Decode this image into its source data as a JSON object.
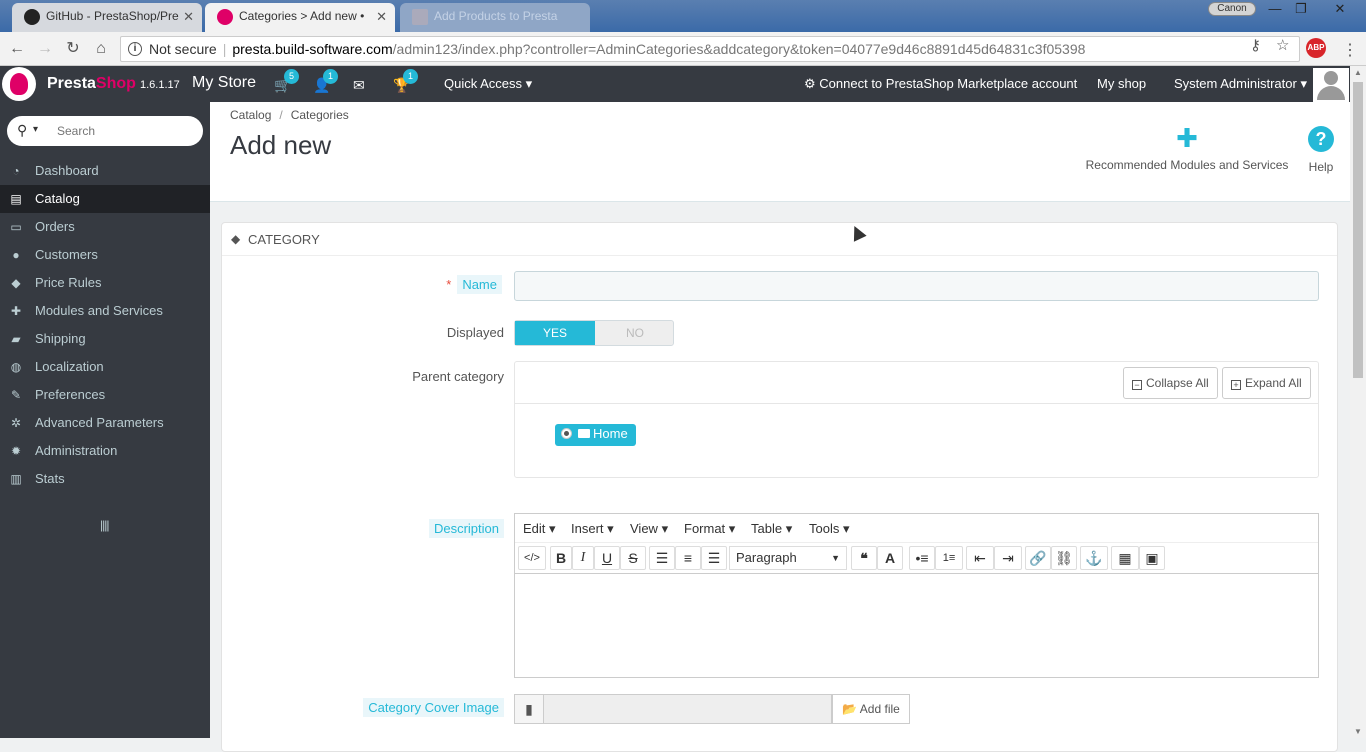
{
  "browser": {
    "tabs": [
      {
        "title": "GitHub - PrestaShop/Pre",
        "close": "✕"
      },
      {
        "title": "Categories > Add new • ",
        "close": "✕"
      },
      {
        "title": "Add Products to Presta",
        "close": ""
      }
    ],
    "canon_label": "Canon",
    "window_controls": {
      "minimize": "—",
      "maximize": "❐",
      "close": "✕"
    },
    "security_label": "Not secure",
    "url_host": "presta.build-software.com",
    "url_path": "/admin123/index.php?controller=AdminCategories&addcategory&token=04077e9d46c8891d45d64831c3f05398",
    "abp_label": "ABP"
  },
  "header": {
    "logo_presta": "Presta",
    "logo_shop": "Shop",
    "version": "1.6.1.17",
    "store_name": "My Store",
    "badges": {
      "orders": "5",
      "customers": "1",
      "achievements": "1"
    },
    "quick_access": "Quick Access",
    "marketplace": "Connect to PrestaShop Marketplace account",
    "my_shop": "My shop",
    "user": "System Administrator"
  },
  "sidebar": {
    "search_placeholder": "Search",
    "items": [
      {
        "label": "Dashboard",
        "icon": "dashboard-icon",
        "glyph": "◔"
      },
      {
        "label": "Catalog",
        "icon": "book-icon",
        "glyph": "▤"
      },
      {
        "label": "Orders",
        "icon": "credit-card-icon",
        "glyph": "▭"
      },
      {
        "label": "Customers",
        "icon": "users-icon",
        "glyph": "●"
      },
      {
        "label": "Price Rules",
        "icon": "tags-icon",
        "glyph": "◆"
      },
      {
        "label": "Modules and Services",
        "icon": "puzzle-icon",
        "glyph": "✚"
      },
      {
        "label": "Shipping",
        "icon": "truck-icon",
        "glyph": "▰"
      },
      {
        "label": "Localization",
        "icon": "globe-icon",
        "glyph": "◍"
      },
      {
        "label": "Preferences",
        "icon": "wrench-icon",
        "glyph": "✎"
      },
      {
        "label": "Advanced Parameters",
        "icon": "cogs-icon",
        "glyph": "✲"
      },
      {
        "label": "Administration",
        "icon": "cog-icon",
        "glyph": "✹"
      },
      {
        "label": "Stats",
        "icon": "bar-chart-icon",
        "glyph": "▥"
      }
    ],
    "active_index": 1,
    "collapse_glyph": "||||"
  },
  "page": {
    "breadcrumb": [
      "Catalog",
      "Categories"
    ],
    "title": "Add new",
    "toolbar": {
      "recommended": "Recommended Modules and Services",
      "help": "Help",
      "help_glyph": "?"
    }
  },
  "form": {
    "panel_title": "Category",
    "name_label": "Name",
    "name_value": "",
    "displayed_label": "Displayed",
    "switch_yes": "YES",
    "switch_no": "NO",
    "parent_label": "Parent category",
    "collapse_all": "Collapse All",
    "expand_all": "Expand All",
    "tree_root": "Home",
    "description_label": "Description",
    "editor_menus": [
      "Edit",
      "Insert",
      "View",
      "Format",
      "Table",
      "Tools"
    ],
    "format_select": "Paragraph",
    "cover_label": "Category Cover Image",
    "add_file": "Add file"
  }
}
